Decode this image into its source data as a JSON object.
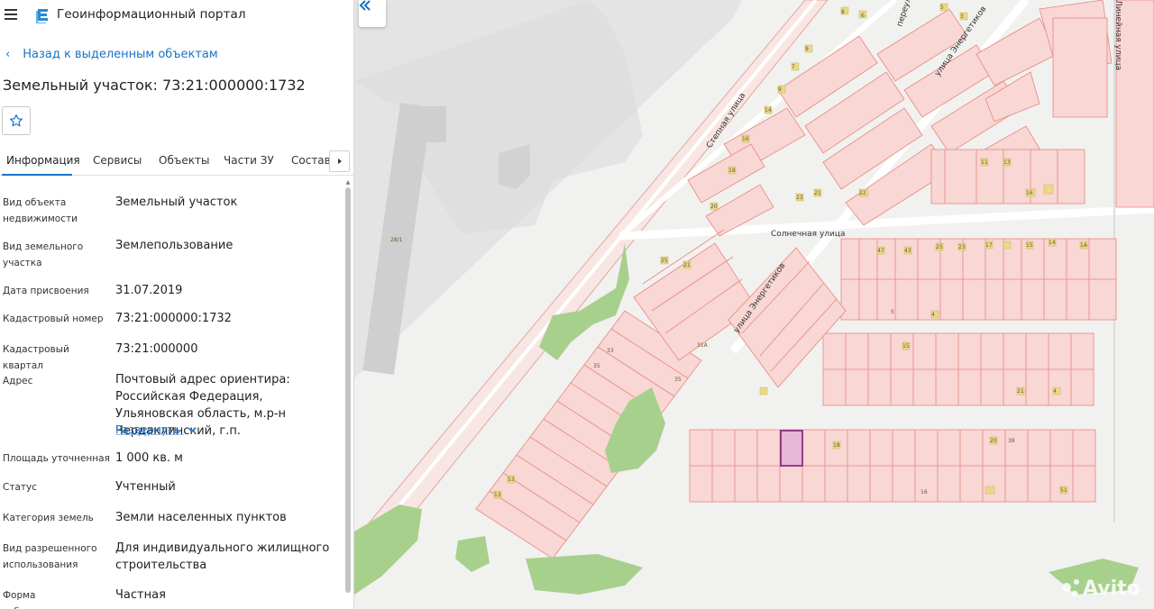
{
  "app": {
    "title": "Геоинформационный портал",
    "icons": {
      "menu": "hamburger-icon",
      "logo": "portal-logo"
    }
  },
  "navigation": {
    "back_label": "Назад к выделенным объектам"
  },
  "object": {
    "title": "Земельный участок: 73:21:000000:1732"
  },
  "tabs": [
    {
      "label": "Информация",
      "active": true
    },
    {
      "label": "Сервисы"
    },
    {
      "label": "Объекты"
    },
    {
      "label": "Части ЗУ"
    },
    {
      "label": "Состав"
    }
  ],
  "properties": [
    {
      "label": "Вид объекта недвижимости",
      "value": "Земельный участок"
    },
    {
      "label": "Вид земельного участка",
      "value": "Землепользование"
    },
    {
      "label": "Дата присвоения",
      "value": "31.07.2019"
    },
    {
      "label": "Кадастровый номер",
      "value": "73:21:000000:1732"
    },
    {
      "label": "Кадастровый квартал",
      "value": "73:21:000000"
    },
    {
      "label": "Адрес",
      "value": "Почтовый адрес ориентира: Российская Федерация, Ульяновская область, м.р-н Чердаклинский, г.п."
    },
    {
      "label": "Площадь уточненная",
      "value": "1 000 кв. м"
    },
    {
      "label": "Статус",
      "value": "Учтенный"
    },
    {
      "label": "Категория земель",
      "value": "Земли населенных пунктов"
    },
    {
      "label": "Вид разрешенного использования",
      "value": "Для индивидуального жилищного строительства"
    },
    {
      "label": "Форма собственности",
      "value": "Частная"
    }
  ],
  "expand_label": "Развернуть",
  "map": {
    "streets": [
      {
        "name": "Степная улица"
      },
      {
        "name": "Солнечная улица"
      },
      {
        "name": "улица Энергетиков"
      },
      {
        "name": "улица Энергетиков"
      },
      {
        "name": "переулок"
      },
      {
        "name": "Линейная улица"
      }
    ],
    "building_labels": [
      "8",
      "6",
      "5",
      "3",
      "4",
      "9",
      "10",
      "8",
      "7",
      "6",
      "4А",
      "11Б",
      "16",
      "9",
      "11",
      "12",
      "11А",
      "14",
      "13",
      "15",
      "10",
      "12",
      "14",
      "16",
      "16А",
      "17",
      "18",
      "19",
      "20",
      "22",
      "23",
      "21",
      "22",
      "24",
      "26",
      "28",
      "17А",
      "14Б",
      "16А",
      "17А",
      "7А",
      "18",
      "19",
      "20",
      "11",
      "13",
      "15",
      "17",
      "9",
      "11",
      "13",
      "16",
      "28/1",
      "21",
      "23",
      "25",
      "27",
      "27А",
      "29",
      "31",
      "31А",
      "33",
      "35",
      "35",
      "27Б",
      "25",
      "26",
      "28",
      "30",
      "32",
      "34",
      "36",
      "38",
      "40",
      "47",
      "45",
      "43",
      "41",
      "39",
      "25",
      "23",
      "21",
      "19",
      "17",
      "15А",
      "15",
      "14",
      "14А",
      "1А",
      "5",
      "4",
      "15",
      "21",
      "4",
      "18",
      "20",
      "38",
      "16",
      "51",
      "53",
      "13"
    ],
    "colors": {
      "parcel_fill": "#f8d7d4",
      "parcel_stroke": "#e8877f",
      "building": "#e9d98a",
      "greenery": "#a8d08d",
      "selected_fill": "#e6b7d6",
      "selected_stroke": "#8e2d7f"
    },
    "watermark": "Avito"
  }
}
